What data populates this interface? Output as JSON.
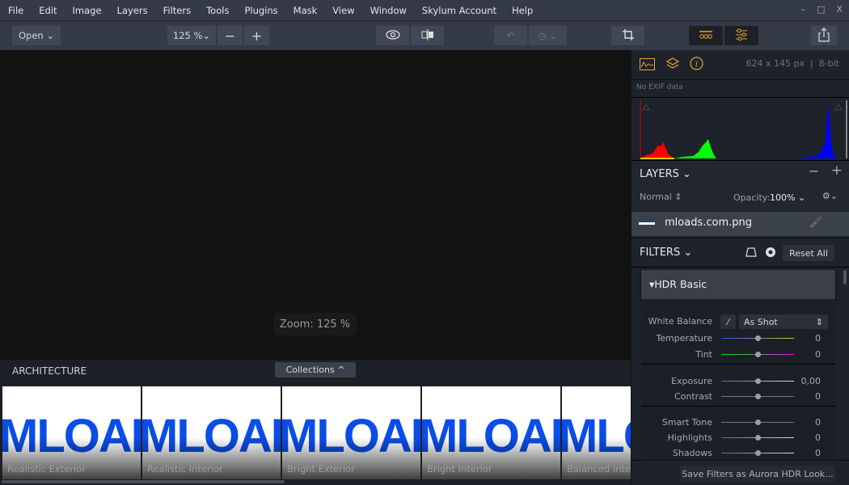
{
  "menu": [
    "File",
    "Edit",
    "Image",
    "Layers",
    "Filters",
    "Tools",
    "Plugins",
    "Mask",
    "View",
    "Window",
    "Skylum Account",
    "Help"
  ],
  "window_controls": {
    "minimize": "–",
    "maximize": "□",
    "close": "X"
  },
  "toolbar": {
    "open_label": "Open",
    "zoom_value": "125 %",
    "minus": "−",
    "plus": "+"
  },
  "canvas": {
    "zoom_badge": "Zoom: 125 %"
  },
  "presets": {
    "category": "ARCHITECTURE",
    "collections_label": "Collections",
    "logo_text": "MLOADS",
    "items": [
      {
        "label": "Realistic Exterior"
      },
      {
        "label": "Realistic Interior"
      },
      {
        "label": "Bright Exterior"
      },
      {
        "label": "Bright Interior"
      },
      {
        "label": "Balanced Interior"
      }
    ]
  },
  "info": {
    "image_info": "624 x 145 px  |  8-bit",
    "exif": "No EXIF data",
    "accent": "#e8a32a"
  },
  "layers": {
    "title": "LAYERS",
    "blend_mode": "Normal",
    "opacity_label": "Opacity:",
    "opacity_value": "100%",
    "layer_name": "mloads.com.png"
  },
  "filters": {
    "title": "FILTERS",
    "reset_label": "Reset All",
    "section": "HDR Basic",
    "white_balance_label": "White Balance",
    "white_balance_value": "As Shot",
    "sliders": [
      {
        "label": "Temperature",
        "value": "0"
      },
      {
        "label": "Tint",
        "value": "0"
      },
      {
        "label": "Exposure",
        "value": "0,00"
      },
      {
        "label": "Contrast",
        "value": "0"
      },
      {
        "label": "Smart Tone",
        "value": "0"
      },
      {
        "label": "Highlights",
        "value": "0"
      },
      {
        "label": "Shadows",
        "value": "0"
      }
    ],
    "save_label": "Save Filters as Aurora HDR Look..."
  }
}
